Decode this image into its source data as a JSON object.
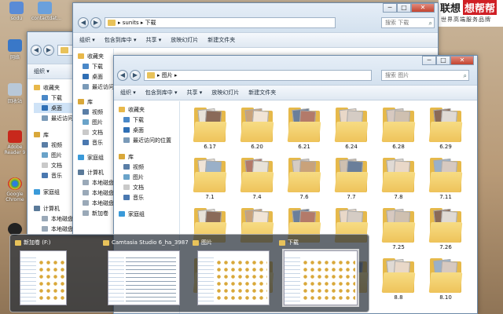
{
  "desktop": {
    "icons": [
      {
        "label": "sodu",
        "color": "#5a8bd6"
      },
      {
        "label": "contactdat...",
        "color": "#6aa0dc"
      },
      {
        "label": "网络",
        "color": "#3a78c8"
      },
      {
        "label": "回收站",
        "color": "#b8c8d8"
      },
      {
        "label": "Adobe Reader 9",
        "color": "#c8281c"
      },
      {
        "label": "Google Chrome",
        "color": "#3fa14a"
      },
      {
        "label": "",
        "color": "#222222"
      }
    ]
  },
  "brand": {
    "part1": "联想",
    "part2": "想帮帮",
    "tagline": "世界高端服务品牌",
    "accent": "#d01f25"
  },
  "window_back": {
    "nav": {
      "favorites": "收藏夹",
      "downloads": "下载",
      "desktop": "桌面",
      "recent": "最近访问的位置",
      "library": "库",
      "video": "视频",
      "pictures": "图片",
      "docs": "文档",
      "music": "音乐",
      "homegroup": "家庭组",
      "computer": "计算机",
      "disk1": "本地磁盘 (C:)",
      "disk2": "本地磁盘 (D:)"
    },
    "toolbar": {
      "organize": "组织 ▾"
    }
  },
  "window_mid": {
    "breadcrumb": "▸ sunits ▸ 下载",
    "search_placeholder": "搜索 下载",
    "toolbar": {
      "organize": "组织 ▾",
      "include": "包含到库中 ▾",
      "share": "共享 ▾",
      "slideshow": "放映幻灯片",
      "newfolder": "新建文件夹"
    },
    "nav": {
      "favorites": "收藏夹",
      "downloads": "下载",
      "desktop": "桌面",
      "recent": "最近访问的位置",
      "library": "库",
      "video": "视频",
      "pictures": "图片",
      "docs": "文档",
      "music": "音乐",
      "homegroup": "家庭组",
      "computer": "计算机",
      "disk1": "本地磁盘",
      "disk2": "本地磁盘",
      "disk3": "本地磁盘",
      "newvol": "新加卷"
    }
  },
  "window_front": {
    "breadcrumb": "▸ 图片 ▸",
    "search_placeholder": "搜索 图片",
    "toolbar": {
      "organize": "组织 ▾",
      "include": "包含到库中 ▾",
      "share": "共享 ▾",
      "slideshow": "放映幻灯片",
      "newfolder": "新建文件夹"
    },
    "nav": {
      "favorites": "收藏夹",
      "downloads": "下载",
      "desktop": "桌面",
      "recent": "最近访问的位置",
      "library": "库",
      "video": "视频",
      "pictures": "图片",
      "docs": "文档",
      "music": "音乐",
      "homegroup": "家庭组"
    },
    "folders": [
      "6.17",
      "6.20",
      "6.21",
      "6.24",
      "6.28",
      "6.29",
      "7.1",
      "7.4",
      "7.6",
      "7.7",
      "7.8",
      "7.11",
      "",
      "",
      "",
      "",
      "7.25",
      "7.26",
      "",
      "",
      "",
      "",
      "8.8",
      "8.10"
    ]
  },
  "switcher": {
    "items": [
      {
        "title": "新加卷 (F:)"
      },
      {
        "title": "Camtasia Studio 6_ha_3987.c..."
      },
      {
        "title": "图片"
      },
      {
        "title": "下载"
      }
    ]
  },
  "window_controls": {
    "minimize": "─",
    "maximize": "□",
    "close": "✕"
  }
}
